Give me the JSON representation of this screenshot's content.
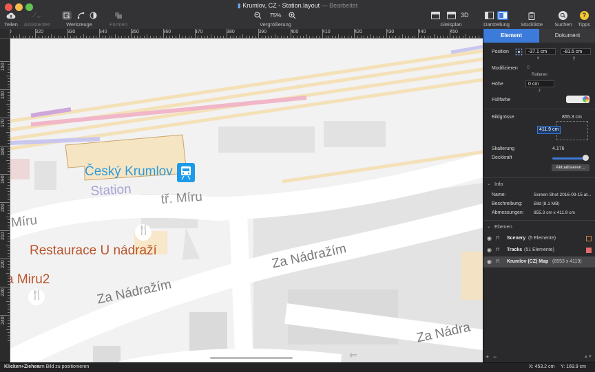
{
  "window": {
    "title": "Krumlov, CZ - Station.layout",
    "separator": "—",
    "subtitle": "Bearbeitet"
  },
  "toolbar": {
    "share": "Teilen",
    "assistants": "Assistenten",
    "tools": "Werkzeuge",
    "shapes": "Formen",
    "zoom_label": "Vergrößerung",
    "zoom_value": "75%",
    "track_plan": "Gleisplan",
    "view_3d": "3D",
    "display": "Darstellung",
    "parts_list": "Stückliste",
    "search": "Suchen",
    "tips": "Tipps"
  },
  "ruler": {
    "h_ticks": [
      "310",
      "320",
      "330",
      "340",
      "350",
      "360",
      "370",
      "380",
      "390",
      "400",
      "410",
      "420",
      "430",
      "440",
      "450"
    ],
    "v_ticks": [
      "150",
      "160",
      "170",
      "180",
      "190",
      "200",
      "210",
      "220",
      "230",
      "240"
    ]
  },
  "map": {
    "station_name": "Český Krumlov",
    "station_word": "Station",
    "street_1": "tř. Míru",
    "street_2": "Míru",
    "restaurant": "Restaurace U nádraží",
    "miru2": "a Miru2",
    "nadrazim_1": "Za Nádražím",
    "nadrazim_2": "Za Nádražím",
    "nadrazim_3": "Za Nádra"
  },
  "sidebar": {
    "tab_element": "Element",
    "tab_document": "Dokument",
    "position_label": "Position",
    "pos_x": "-37.1 cm",
    "pos_y": "-81.5 cm",
    "x_axis": "x",
    "y_axis": "y",
    "modify_label": "Modifizieren",
    "rotate_value": "0",
    "rotate_label": "Rotieren",
    "height_label": "Höhe",
    "height_value": "0 cm",
    "z_axis": "z",
    "fill_label": "Füllfarbe",
    "image_size_label": "Bildgrösse",
    "image_width": "855.3 cm",
    "image_height": "411.9 cm",
    "scale_label": "Skalierung",
    "scale_value": "4.176",
    "opacity_label": "Deckkraft",
    "update_button": "Aktualisieren...",
    "info_header": "Info",
    "name_label": "Name:",
    "name_value": "Screen Shot 2016-09-15 at...",
    "desc_label": "Beschreibung:",
    "desc_value": "Bild (8.1 MB)",
    "dims_label": "Abmessungen:",
    "dims_value": "855.3 cm x 411.9 cm",
    "layers_header": "Ebenen",
    "layers": [
      {
        "name": "Scenery",
        "count": "(5 Elemente)"
      },
      {
        "name": "Tracks",
        "count": "(51 Elemente)"
      },
      {
        "name": "Krumlov (CZ) Map",
        "count": "(8553 x 4119)"
      }
    ],
    "add": "+",
    "remove": "−"
  },
  "status": {
    "hint_bold": "Klicken+Ziehen",
    "hint_rest": "um Bild zu positionieren",
    "coord_x": "X: 453.2 cm",
    "coord_y": "Y: 169.9 cm"
  },
  "colors": {
    "accent": "#3c7bd9",
    "tracks_swatch": "#e26b6b",
    "scenery_swatch": "#c8824a"
  }
}
